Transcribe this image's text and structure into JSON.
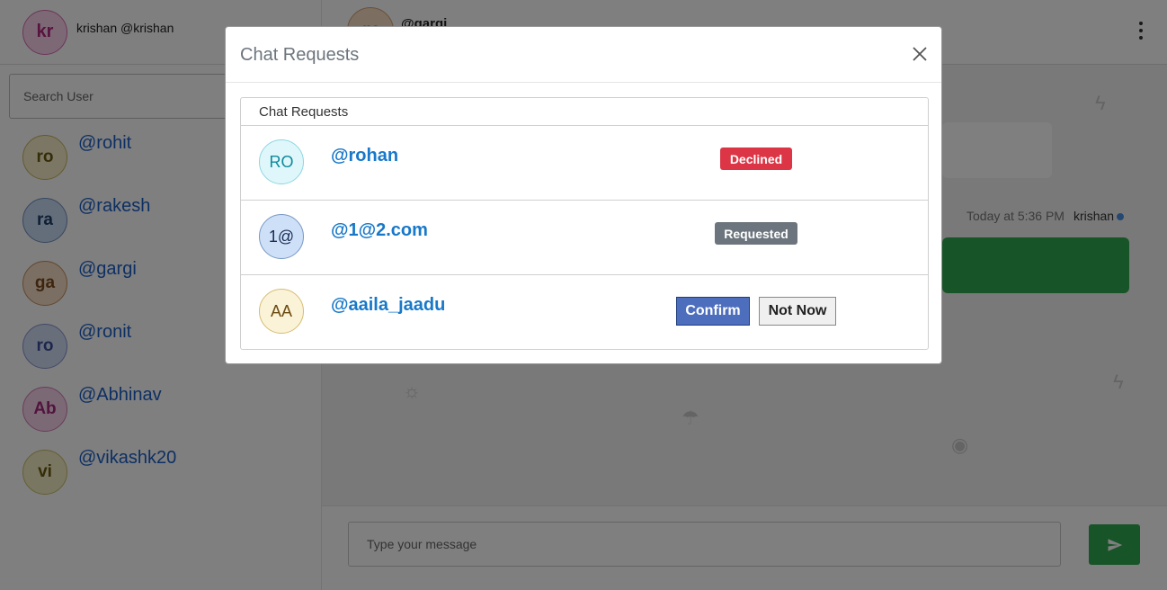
{
  "me": {
    "initials": "kr",
    "name": "krishan @krishan"
  },
  "search": {
    "placeholder": "Search User"
  },
  "users": [
    {
      "initials": "ro",
      "handle": "@rohit",
      "bg": "#f6efc8",
      "fg": "#6b5a10",
      "border": "#c7b560"
    },
    {
      "initials": "ra",
      "handle": "@rakesh",
      "bg": "#c9dcf5",
      "fg": "#1f3e6e",
      "border": "#6d8fbf"
    },
    {
      "initials": "ga",
      "handle": "@gargi",
      "bg": "#f6dcc4",
      "fg": "#7a4a1f",
      "border": "#c48f5f"
    },
    {
      "initials": "ro",
      "handle": "@ronit",
      "bg": "#d3dcf7",
      "fg": "#3b4f9a",
      "border": "#8594cf"
    },
    {
      "initials": "Ab",
      "handle": "@Abhinav",
      "bg": "#f8d3ec",
      "fg": "#a3297a",
      "border": "#d27ab5"
    },
    {
      "initials": "vi",
      "handle": "@vikashk20",
      "bg": "#f3eec2",
      "fg": "#6b5a10",
      "border": "#c9bd6a"
    }
  ],
  "chat": {
    "peer_initials": "ga",
    "peer_handle": "@gargi",
    "message_time": "Today at 5:36 PM",
    "message_author": "krishan",
    "composer_placeholder": "Type your message"
  },
  "modal": {
    "title": "Chat Requests",
    "card_title": "Chat Requests",
    "requests": [
      {
        "initials": "RO",
        "handle": "@rohan",
        "status": "Declined"
      },
      {
        "initials": "1@",
        "handle": "@1@2.com",
        "status": "Requested"
      },
      {
        "initials": "AA",
        "handle": "@aaila_jaadu",
        "confirm_label": "Confirm",
        "not_now_label": "Not Now"
      }
    ]
  },
  "colors": {
    "send": "#2fa84f",
    "declined": "#dc3545",
    "requested": "#6c757d",
    "link": "#1878c9"
  }
}
